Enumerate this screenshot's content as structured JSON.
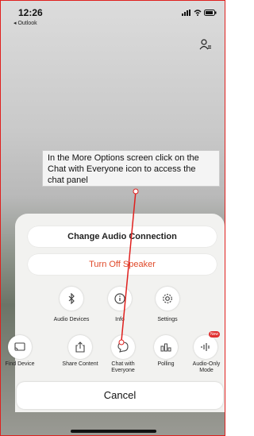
{
  "status": {
    "time": "12:26",
    "back_app": "◂ Outlook"
  },
  "callout": {
    "text": "In the More Options screen click on the Chat with Everyone icon to access the chat panel"
  },
  "sheet": {
    "change_audio": "Change Audio Connection",
    "turn_off_speaker": "Turn Off Speaker",
    "row1": [
      {
        "label": "Audio Devices",
        "icon": "bluetooth-icon"
      },
      {
        "label": "Info",
        "icon": "info-icon"
      },
      {
        "label": "Settings",
        "icon": "gear-icon"
      }
    ],
    "row2": [
      {
        "label": "Find Device",
        "icon": "cast-icon"
      },
      {
        "label": "Share Content",
        "icon": "share-icon"
      },
      {
        "label": "Chat with Everyone",
        "icon": "chat-icon"
      },
      {
        "label": "Polling",
        "icon": "polling-icon"
      },
      {
        "label": "Audio-Only Mode",
        "icon": "audio-wave-icon",
        "badge": "New"
      }
    ],
    "cancel": "Cancel"
  },
  "colors": {
    "accent": "#e04a2a",
    "annotation": "#e0201e"
  }
}
